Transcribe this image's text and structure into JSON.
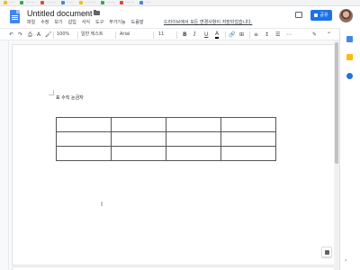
{
  "document": {
    "title": "Untitled document",
    "save_status": "드라이브에서 모든 변경사항이 저장되었습니다.",
    "body_text": "표 수직 눈금자",
    "table": {
      "rows": 3,
      "cols": 4
    }
  },
  "menu": [
    "파일",
    "수정",
    "보기",
    "삽입",
    "서식",
    "도구",
    "부가기능",
    "도움말"
  ],
  "header": {
    "share_label": "공유",
    "brand_color": "#4285f4",
    "share_color": "#1a73e8"
  },
  "toolbar": {
    "undo_icon": "↶",
    "redo_icon": "↷",
    "print_icon": "⎙",
    "spellcheck_icon": "A",
    "paint_format_icon": "🖌",
    "zoom": "100%",
    "style": "일반 텍스트",
    "font": "Arial",
    "font_size": "11",
    "bold": "B",
    "italic": "I",
    "underline": "U",
    "text_color": "A",
    "link_icon": "🔗",
    "comment_icon": "⊞",
    "align_icon": "≡",
    "line_spacing_icon": "↕",
    "list_icon": "☰",
    "more_icon": "⋯",
    "edit_mode_icon": "✎",
    "collapse_icon": "⌃"
  },
  "side_panel": {
    "icons": [
      "calendar-icon",
      "keep-icon",
      "tasks-icon"
    ],
    "collapse_icon": "›"
  },
  "misc": {
    "text_cursor": "I",
    "star_icon": "☆"
  }
}
